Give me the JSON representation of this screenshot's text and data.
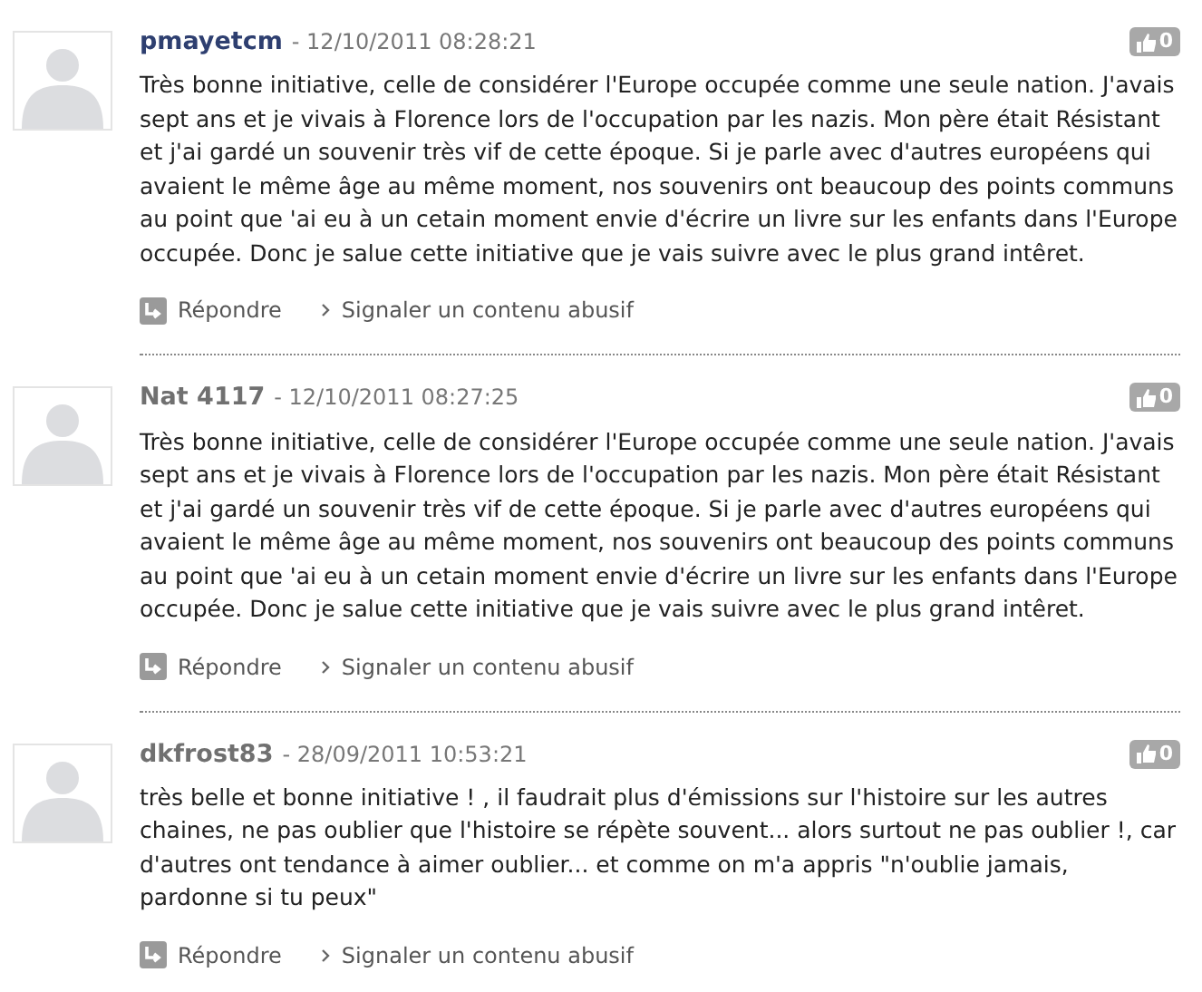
{
  "comments": [
    {
      "author": "pmayetcm",
      "color": "#2e3f70",
      "date": "- 12/10/2011 08:28:21",
      "likes": "0",
      "body": "Très bonne initiative, celle de considérer l'Europe occupée comme une seule nation. J'avais sept ans et je vivais à Florence lors de l'occupation par les nazis. Mon père était Résistant et j'ai gardé un souvenir très vif de cette époque. Si je parle avec d'autres européens qui avaient le même âge au même moment, nos souvenirs ont beaucoup des points communs au point que 'ai eu à un cetain moment envie d'écrire un livre sur les enfants dans l'Europe occupée. Donc je salue cette initiative que je vais suivre avec le plus grand intêret.",
      "reply": "Répondre",
      "report": "Signaler un contenu abusif"
    },
    {
      "author": "Nat 4117",
      "color": "#707070",
      "date": "- 12/10/2011 08:27:25",
      "likes": "0",
      "body": "Très bonne initiative, celle de considérer l'Europe occupée comme une seule nation. J'avais sept ans et je vivais à Florence lors de l'occupation par les nazis. Mon père était Résistant et j'ai gardé un souvenir très vif de cette époque. Si je parle avec d'autres européens qui avaient le même âge au même moment, nos souvenirs ont beaucoup des points communs au point que 'ai eu à un cetain moment envie d'écrire un livre sur les enfants dans l'Europe occupée. Donc je salue cette initiative que je vais suivre avec le plus grand intêret.",
      "reply": "Répondre",
      "report": "Signaler un contenu abusif"
    },
    {
      "author": "dkfrost83",
      "color": "#707070",
      "date": "- 28/09/2011 10:53:21",
      "likes": "0",
      "body": "très belle et bonne initiative ! , il faudrait plus d'émissions sur l'histoire sur les autres chaines, ne pas oublier que l'histoire se répète souvent... alors surtout ne pas oublier !, car d'autres ont tendance à aimer oublier... et comme on m'a appris \"n'oublie jamais, pardonne si tu peux\"",
      "reply": "Répondre",
      "report": "Signaler un contenu abusif"
    }
  ]
}
